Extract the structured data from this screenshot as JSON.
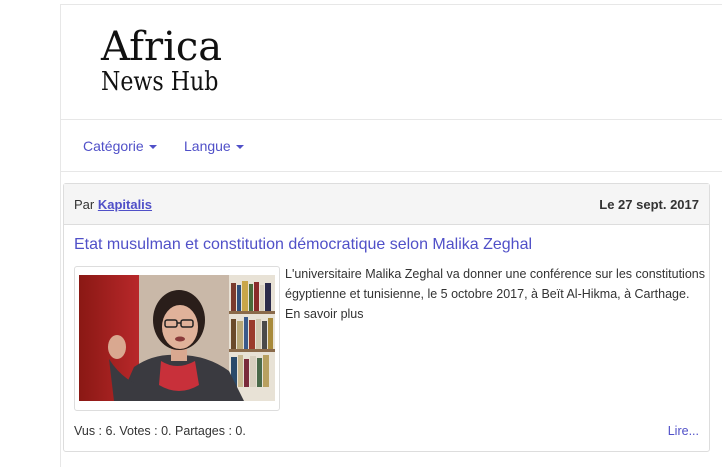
{
  "site": {
    "logo_line1": "Africa",
    "logo_line2": "News Hub"
  },
  "nav": {
    "items": [
      {
        "label": "Catégorie"
      },
      {
        "label": "Langue"
      }
    ]
  },
  "article": {
    "by_prefix": "Par ",
    "author": "Kapitalis",
    "date": "Le 27 sept. 2017",
    "title": "Etat musulman et constitution démocratique selon Malika Zeghal",
    "summary": " L'universitaire Malika Zeghal va donner une conférence sur les constitutions égyptienne et tunisienne, le 5 octobre 2017, à Beït Al-Hikma, à Carthage.",
    "more": "En savoir plus",
    "stats": "Vus : 6. Votes : 0. Partages : 0.",
    "read_more": "Lire..."
  },
  "colors": {
    "link": "#5050c8",
    "header_bg": "#f5f5f5",
    "border": "#dddddd"
  }
}
